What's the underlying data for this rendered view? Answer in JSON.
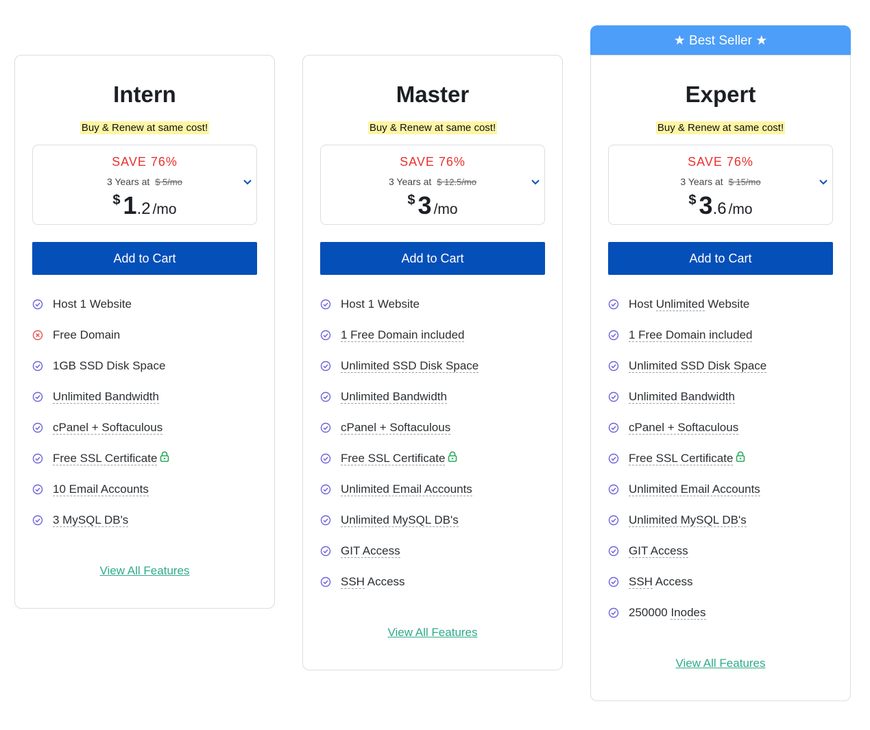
{
  "ribbon": {
    "label": "★ Best Seller ★"
  },
  "colors": {
    "accent": "#054fb9",
    "ribbon": "#4d9ef8",
    "save": "#e8312e",
    "link": "#2eab8a",
    "check": "#6c63d9",
    "cross": "#e25555",
    "lock": "#2aa85a",
    "highlight": "#fdf5a6"
  },
  "plans": [
    {
      "name": "Intern",
      "renew_note": "Buy & Renew at same cost!",
      "save_label": "SAVE 76%",
      "term": "3 Years at",
      "old_price": "$ 5/mo",
      "currency": "$",
      "price_whole": "1",
      "price_frac": ".2",
      "per": "/mo",
      "cart_label": "Add to Cart",
      "view_all_label": "View All Features",
      "features": [
        {
          "pre": "Host 1 Website",
          "u": "",
          "post": "",
          "icon": "check-icon"
        },
        {
          "pre": "Free Domain",
          "u": "",
          "post": "",
          "icon": "cross-icon"
        },
        {
          "pre": "1GB SSD Disk Space",
          "u": "",
          "post": "",
          "icon": "check-icon"
        },
        {
          "pre": "",
          "u": "Unlimited Bandwidth",
          "post": "",
          "icon": "check-icon"
        },
        {
          "pre": "",
          "u": "cPanel + Softaculous",
          "post": "",
          "icon": "check-icon"
        },
        {
          "pre": "",
          "u": "Free SSL Certificate",
          "post": "",
          "icon": "check-icon",
          "lock": true
        },
        {
          "pre": "",
          "u": "10 Email Accounts",
          "post": "",
          "icon": "check-icon"
        },
        {
          "pre": "",
          "u": "3 MySQL DB's",
          "post": "",
          "icon": "check-icon"
        }
      ]
    },
    {
      "name": "Master",
      "renew_note": "Buy & Renew at same cost!",
      "save_label": "SAVE 76%",
      "term": "3 Years at",
      "old_price": "$ 12.5/mo",
      "currency": "$",
      "price_whole": "3",
      "price_frac": "",
      "per": "/mo",
      "cart_label": "Add to Cart",
      "view_all_label": "View All Features",
      "features": [
        {
          "pre": "Host 1 Website",
          "u": "",
          "post": "",
          "icon": "check-icon"
        },
        {
          "pre": "",
          "u": "1 Free Domain included",
          "post": "",
          "icon": "check-icon"
        },
        {
          "pre": "",
          "u": "Unlimited SSD Disk Space",
          "post": "",
          "icon": "check-icon"
        },
        {
          "pre": "",
          "u": "Unlimited Bandwidth",
          "post": "",
          "icon": "check-icon"
        },
        {
          "pre": "",
          "u": "cPanel + Softaculous",
          "post": "",
          "icon": "check-icon"
        },
        {
          "pre": "",
          "u": "Free SSL Certificate",
          "post": "",
          "icon": "check-icon",
          "lock": true
        },
        {
          "pre": "",
          "u": "Unlimited Email Accounts",
          "post": "",
          "icon": "check-icon"
        },
        {
          "pre": "",
          "u": "Unlimited MySQL DB's",
          "post": "",
          "icon": "check-icon"
        },
        {
          "pre": "",
          "u": "GIT Access",
          "post": "",
          "icon": "check-icon"
        },
        {
          "pre": "",
          "u": "SSH",
          "post": " Access",
          "icon": "check-icon"
        }
      ]
    },
    {
      "name": "Expert",
      "renew_note": "Buy & Renew at same cost!",
      "save_label": "SAVE 76%",
      "term": "3 Years at",
      "old_price": "$ 15/mo",
      "currency": "$",
      "price_whole": "3",
      "price_frac": ".6",
      "per": "/mo",
      "cart_label": "Add to Cart",
      "view_all_label": "View All Features",
      "features": [
        {
          "pre": "Host ",
          "u": "Unlimited",
          "post": " Website",
          "icon": "check-icon"
        },
        {
          "pre": "",
          "u": "1 Free Domain included",
          "post": "",
          "icon": "check-icon"
        },
        {
          "pre": "",
          "u": "Unlimited SSD Disk Space",
          "post": "",
          "icon": "check-icon"
        },
        {
          "pre": "",
          "u": "Unlimited Bandwidth",
          "post": "",
          "icon": "check-icon"
        },
        {
          "pre": "",
          "u": "cPanel + Softaculous",
          "post": "",
          "icon": "check-icon"
        },
        {
          "pre": "",
          "u": "Free SSL Certificate",
          "post": "",
          "icon": "check-icon",
          "lock": true
        },
        {
          "pre": "",
          "u": "Unlimited Email Accounts",
          "post": "",
          "icon": "check-icon"
        },
        {
          "pre": "",
          "u": "Unlimited MySQL DB's",
          "post": "",
          "icon": "check-icon"
        },
        {
          "pre": "",
          "u": "GIT Access",
          "post": "",
          "icon": "check-icon"
        },
        {
          "pre": "",
          "u": "SSH",
          "post": " Access",
          "icon": "check-icon"
        },
        {
          "pre": "250000 ",
          "u": "Inodes",
          "post": "",
          "icon": "check-icon"
        }
      ]
    }
  ]
}
